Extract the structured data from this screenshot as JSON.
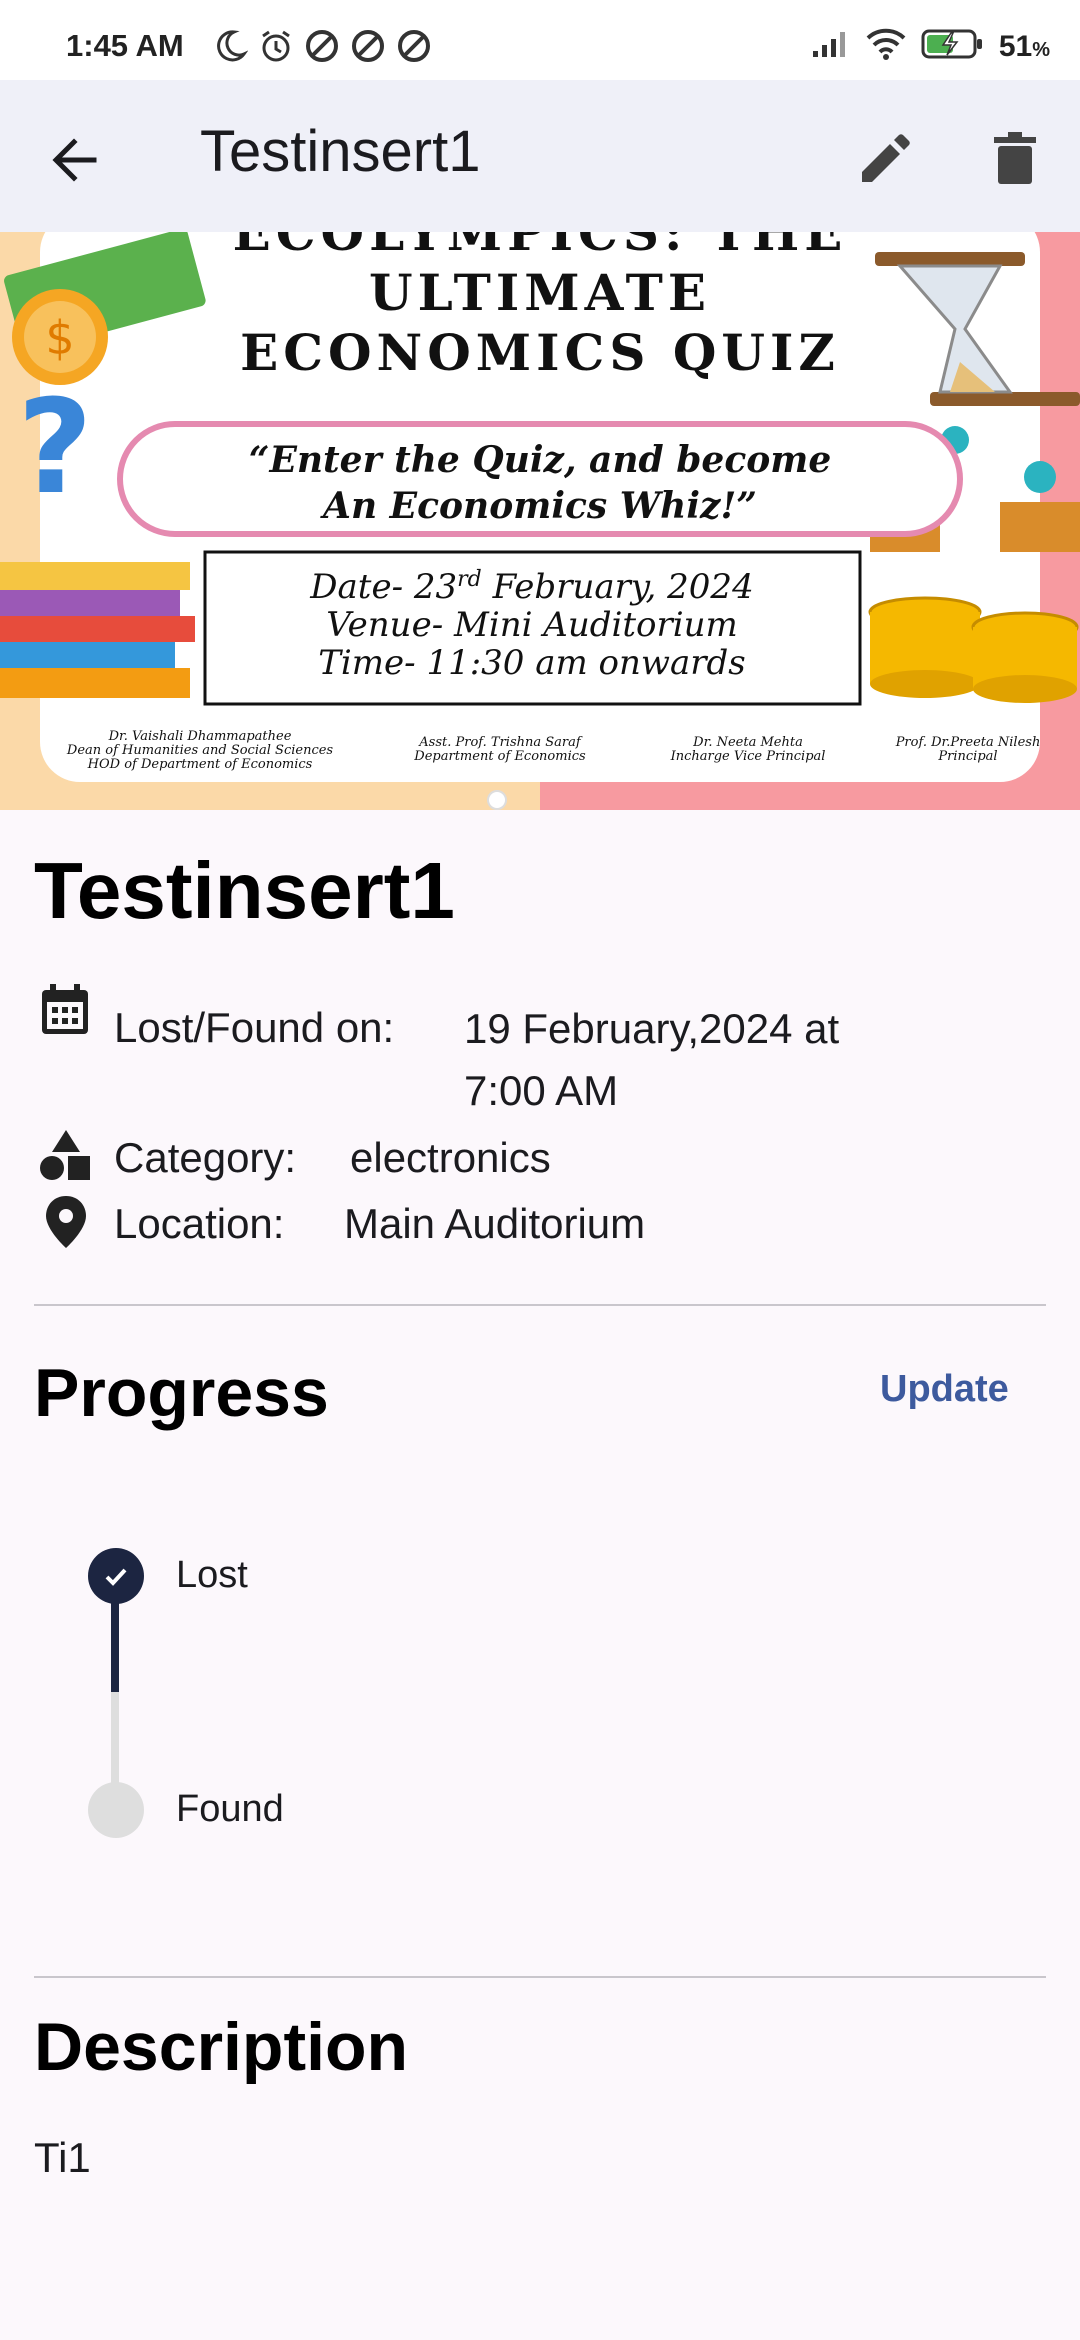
{
  "status_bar": {
    "time": "1:45 AM",
    "battery_percent": "51",
    "battery_unit": "%",
    "icons": [
      "moon-icon",
      "alarm-icon",
      "blocked-icon",
      "blocked-icon",
      "blocked-icon",
      "signal-icon",
      "wifi-icon",
      "battery-charging-icon"
    ]
  },
  "app_bar": {
    "title": "Testinsert1",
    "icons": [
      "arrow-back-icon",
      "pencil-icon",
      "trash-icon"
    ]
  },
  "poster": {
    "headline_top": "ECOLYMPICS: THE",
    "headline_line2": "ULTIMATE",
    "headline_line3": "ECONOMICS QUIZ",
    "tagline_1": "“Enter the Quiz, and become",
    "tagline_2": "An Economics Whiz!”",
    "date_prefix": "Date- 23",
    "date_sup": "rd",
    "date_suffix": " February, 2024",
    "venue": "Venue- Mini Auditorium",
    "time": "Time- 11:30 am onwards",
    "credits": [
      {
        "name": "Dr. Vaishali Dhammapathee",
        "role1": "Dean of Humanities and Social Sciences",
        "role2": "HOD of Department of Economics"
      },
      {
        "name": "Asst. Prof. Trishna Saraf",
        "role1": "Department of Economics",
        "role2": ""
      },
      {
        "name": "Dr. Neeta Mehta",
        "role1": "Incharge Vice Principal",
        "role2": ""
      },
      {
        "name": "Prof. Dr.Preeta Nilesh",
        "role1": "Principal",
        "role2": ""
      }
    ]
  },
  "item": {
    "title": "Testinsert1",
    "lost_found_label": "Lost/Found on:",
    "lost_found_value_line1": "19 February,2024 at",
    "lost_found_value_line2": "7:00 AM",
    "category_label": "Category:",
    "category_value": "electronics",
    "location_label": "Location:",
    "location_value": "Main Auditorium"
  },
  "progress": {
    "title": "Progress",
    "update_label": "Update",
    "steps": [
      {
        "label": "Lost",
        "done": true
      },
      {
        "label": "Found",
        "done": false
      }
    ],
    "colors": {
      "active": "#1c2541",
      "inactive": "#dedede"
    }
  },
  "description": {
    "title": "Description",
    "text": "Ti1"
  }
}
